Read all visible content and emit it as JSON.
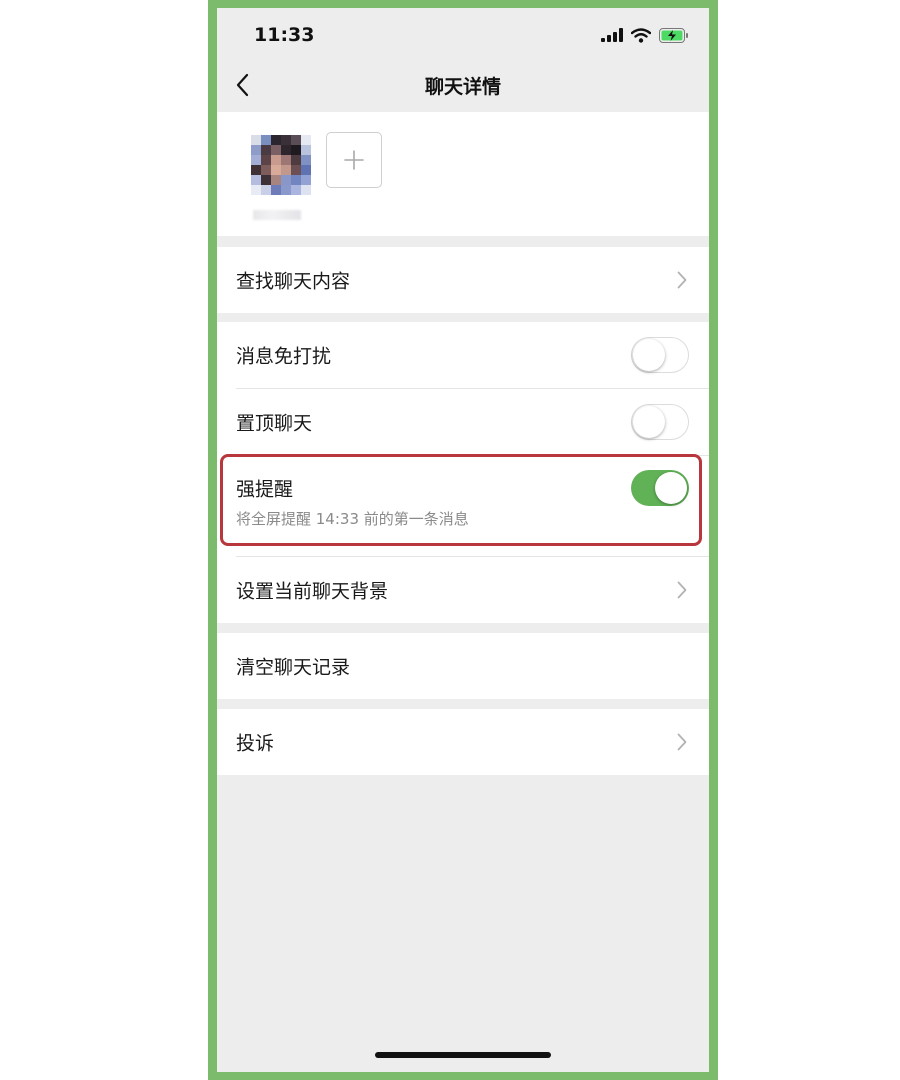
{
  "status_bar": {
    "time": "11:33"
  },
  "nav": {
    "title": "聊天详情"
  },
  "members": {
    "add_label": "+"
  },
  "rows": {
    "search": {
      "label": "查找聊天内容"
    },
    "mute": {
      "label": "消息免打扰",
      "enabled": false
    },
    "pin": {
      "label": "置顶聊天",
      "enabled": false
    },
    "strong_reminder": {
      "label": "强提醒",
      "sublabel": "将全屏提醒 14:33 前的第一条消息",
      "enabled": true
    },
    "background": {
      "label": "设置当前聊天背景"
    },
    "clear": {
      "label": "清空聊天记录"
    },
    "report": {
      "label": "投诉"
    }
  },
  "colors": {
    "frame_border": "#7cba6c",
    "toggle_on": "#61b257",
    "highlight_border": "#b8373c",
    "page_background": "#ededed"
  },
  "icons": [
    "back-chevron-icon",
    "signal-icon",
    "wifi-icon",
    "battery-charging-icon",
    "chevron-right-icon",
    "plus-icon"
  ]
}
